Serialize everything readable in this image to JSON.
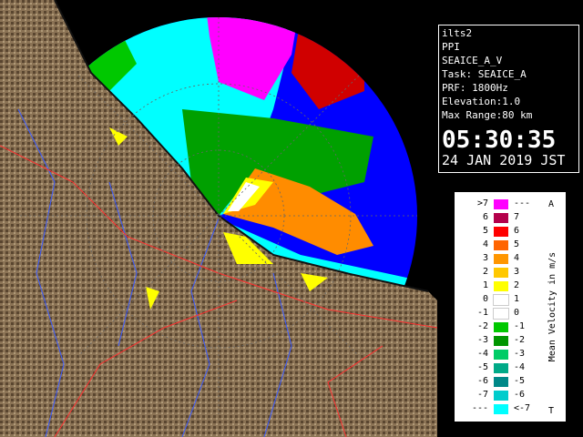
{
  "info": {
    "site": "ilts2",
    "product": "PPI",
    "scan": "SEAICE_A_V",
    "task": "Task: SEAICE_A",
    "prf": "PRF: 1800Hz",
    "elevation": "Elevation:1.0",
    "max_range": "Max Range:80 km",
    "time": "05:30:35",
    "date": "24 JAN 2019 JST"
  },
  "legend": {
    "title": "Mean Velocity in m/s",
    "top_mark": "A",
    "bottom_mark": "T",
    "left_labels": [
      ">7",
      "6",
      "5",
      "4",
      "3",
      "2",
      "1",
      "0",
      "-1",
      "-2",
      "-3",
      "-4",
      "-5",
      "-6",
      "-7",
      "---"
    ],
    "right_labels": [
      "---",
      "7",
      "6",
      "5",
      "4",
      "3",
      "2",
      "1",
      "0",
      "-1",
      "-2",
      "-3",
      "-4",
      "-5",
      "-6",
      "<-7"
    ],
    "colors": [
      "#ff00ff",
      "#b4004b",
      "#ff0000",
      "#ff6400",
      "#ff9600",
      "#ffc800",
      "#ffff00",
      "#ffffff",
      "#ffffff",
      "#00c800",
      "#009600",
      "#00cc66",
      "#00aa88",
      "#008888",
      "#00cccc",
      "#00ffff"
    ]
  },
  "colors": {
    "range_ring": "#0000ff",
    "land": "#8b7355",
    "sea_ice_toward": "#00ffff",
    "sea_ice_away": "#ff00ff"
  }
}
